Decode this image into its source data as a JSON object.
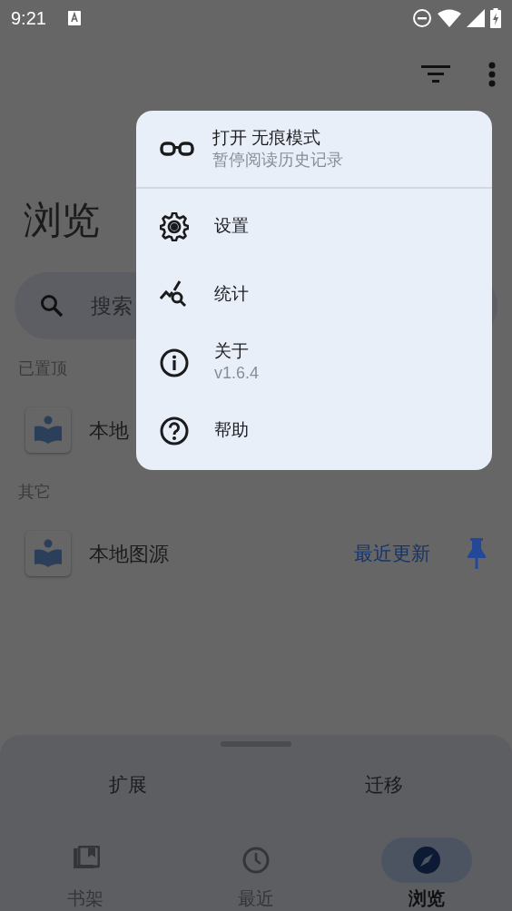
{
  "status_bar": {
    "time": "9:21"
  },
  "page": {
    "title": "浏览",
    "search": {
      "placeholder": "搜索"
    }
  },
  "sections": [
    {
      "header": "已置顶",
      "items": [
        {
          "name": "本地"
        }
      ]
    },
    {
      "header": "其它",
      "items": [
        {
          "name": "本地图源",
          "action": "最近更新"
        }
      ]
    }
  ],
  "menu": {
    "toggle": {
      "label": "打开 无痕模式",
      "subtitle": "暂停阅读历史记录"
    },
    "items": [
      {
        "kind": "settings",
        "label": "设置"
      },
      {
        "kind": "stats",
        "label": "统计"
      },
      {
        "kind": "info",
        "label": "关于",
        "subtitle": "v1.6.4"
      },
      {
        "kind": "help",
        "label": "帮助"
      }
    ]
  },
  "sheet": {
    "tabs": [
      {
        "label": "扩展"
      },
      {
        "label": "迁移"
      }
    ]
  },
  "bottom_nav": [
    {
      "kind": "library",
      "label": "书架",
      "selected": false
    },
    {
      "kind": "history",
      "label": "最近",
      "selected": false
    },
    {
      "kind": "browse",
      "label": "浏览",
      "selected": true
    }
  ]
}
